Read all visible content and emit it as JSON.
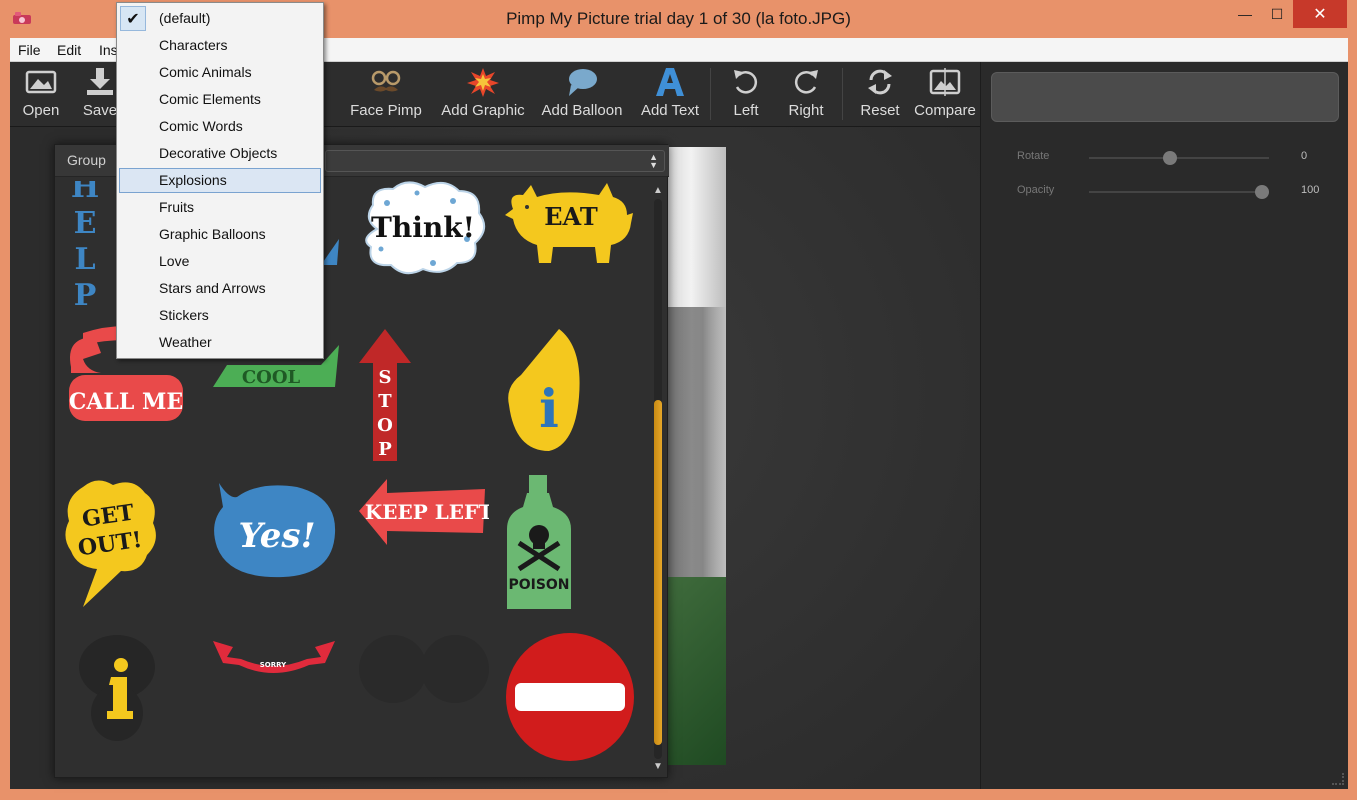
{
  "window": {
    "title": "Pimp My Picture trial day 1 of 30 (la foto.JPG)",
    "controls": {
      "minimize": "—",
      "maximize": "☐",
      "close": "✕"
    }
  },
  "menubar": [
    "File",
    "Edit",
    "Ins"
  ],
  "toolbar": {
    "open": "Open",
    "save": "Save",
    "face_pimp": "Face Pimp",
    "add_graphic": "Add Graphic",
    "add_balloon": "Add Balloon",
    "add_text": "Add Text",
    "left": "Left",
    "right": "Right",
    "reset": "Reset",
    "compare": "Compare"
  },
  "graphic_panel": {
    "group_label": "Group",
    "stickers": {
      "help": [
        "H",
        "E",
        "L",
        "P"
      ],
      "think": "Think!",
      "eat": "EAT",
      "call_me": "CALL ME",
      "cool": "COOL",
      "stop": [
        "S",
        "T",
        "O",
        "P"
      ],
      "info": "i",
      "get_out": [
        "GET",
        "OUT!"
      ],
      "yes": "Yes!",
      "keep_left": "KEEP LEFT",
      "poison": "POISON",
      "sorry": "SORRY"
    }
  },
  "dropdown": {
    "check_mark": "✔",
    "items": [
      "(default)",
      "Characters",
      "Comic Animals",
      "Comic Elements",
      "Comic Words",
      "Decorative Objects",
      "Explosions",
      "Fruits",
      "Graphic Balloons",
      "Love",
      "Stars and Arrows",
      "Stickers",
      "Weather"
    ],
    "checked_index": 0,
    "highlighted_index": 6
  },
  "right_panel": {
    "rotate": {
      "label": "Rotate",
      "value": "0",
      "fraction": 0.45
    },
    "opacity": {
      "label": "Opacity",
      "value": "100",
      "fraction": 1.0
    }
  },
  "colors": {
    "window_frame": "#e8926a",
    "toolbar_bg": "#2d2d2d",
    "close_button": "#c7392a",
    "scroll_thumb": "#e6a628",
    "dropdown_highlight": "#dbe6f3"
  },
  "icons": {
    "open": "image-frame-icon",
    "save": "download-icon",
    "face_pimp": "mustache-glasses-icon",
    "add_graphic": "explosion-icon",
    "add_balloon": "speech-balloon-icon",
    "add_text": "letter-a-icon",
    "left": "rotate-left-icon",
    "right": "rotate-right-icon",
    "reset": "refresh-icon",
    "compare": "image-compare-icon"
  }
}
